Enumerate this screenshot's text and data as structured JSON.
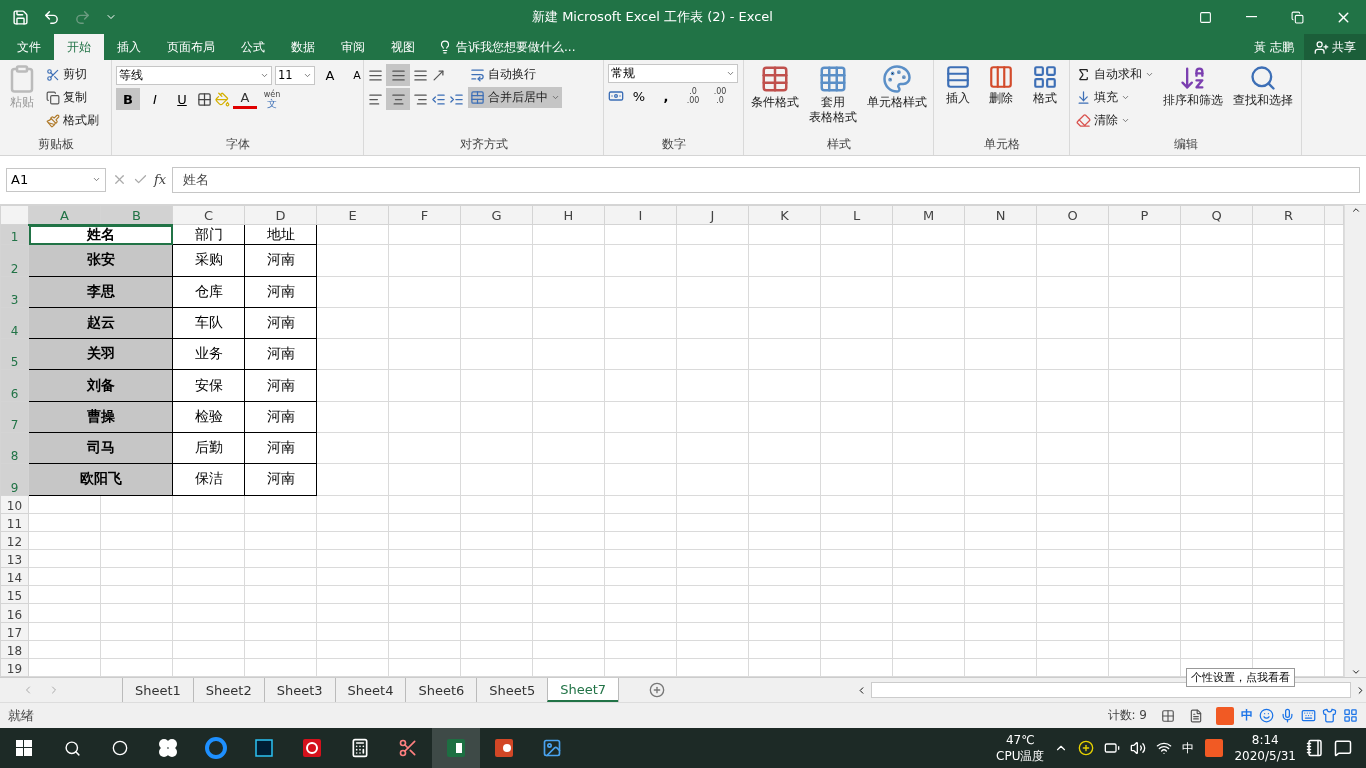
{
  "window": {
    "title": "新建 Microsoft Excel 工作表 (2) - Excel"
  },
  "ribbon_tabs": [
    {
      "label": "文件",
      "selected": false
    },
    {
      "label": "开始",
      "selected": true
    },
    {
      "label": "插入",
      "selected": false
    },
    {
      "label": "页面布局",
      "selected": false
    },
    {
      "label": "公式",
      "selected": false
    },
    {
      "label": "数据",
      "selected": false
    },
    {
      "label": "审阅",
      "selected": false
    },
    {
      "label": "视图",
      "selected": false
    }
  ],
  "tell_me": "告诉我您想要做什么...",
  "user": "黃 志鹏",
  "share": "共享",
  "clipboard": {
    "label": "剪贴板",
    "paste": "粘贴",
    "cut": "剪切",
    "copy": "复制",
    "painter": "格式刷"
  },
  "font": {
    "label": "字体",
    "font_name": "等线",
    "font_size": "11",
    "grow": "A",
    "shrink": "A",
    "bold": "B",
    "italic": "I",
    "underline": "U",
    "font_color": "A",
    "phonetic_top": "wén",
    "phonetic_bottom": "文"
  },
  "alignment": {
    "label": "对齐方式",
    "wrap": "自动换行",
    "merge": "合并后居中",
    "merge_on": true
  },
  "number": {
    "label": "数字",
    "format": "常规",
    "percent": "%",
    "comma": ",",
    "increase_top": ".0",
    "increase_bottom": ".00",
    "decrease_top": ".00",
    "decrease_bottom": ".0"
  },
  "styles": {
    "label": "样式",
    "items": [
      {
        "label": "条件格式",
        "kind": "conditional"
      },
      {
        "label": "套用",
        "label2": "表格格式",
        "kind": "table"
      },
      {
        "label": "单元格样式",
        "kind": "cellstyle"
      }
    ]
  },
  "cells": {
    "label": "单元格",
    "items": [
      {
        "label": "插入",
        "kind": "insert"
      },
      {
        "label": "删除",
        "kind": "delete"
      },
      {
        "label": "格式",
        "kind": "format"
      }
    ]
  },
  "editing": {
    "label": "编辑",
    "autosum": "自动求和",
    "fill": "填充",
    "clear": "清除",
    "sort": "排序和筛选",
    "find": "查找和选择"
  },
  "formula_bar": {
    "name_box": "A1",
    "fx": "fx",
    "value": "姓名"
  },
  "sheet": {
    "columns": [
      {
        "label": "A",
        "selected": true
      },
      {
        "label": "B",
        "selected": true
      },
      {
        "label": "C",
        "selected": false
      },
      {
        "label": "D",
        "selected": false
      },
      {
        "label": "E",
        "selected": false
      },
      {
        "label": "F",
        "selected": false
      },
      {
        "label": "G",
        "selected": false
      },
      {
        "label": "H",
        "selected": false
      },
      {
        "label": "I",
        "selected": false
      },
      {
        "label": "J",
        "selected": false
      },
      {
        "label": "K",
        "selected": false
      },
      {
        "label": "L",
        "selected": false
      },
      {
        "label": "M",
        "selected": false
      },
      {
        "label": "N",
        "selected": false
      },
      {
        "label": "O",
        "selected": false
      },
      {
        "label": "P",
        "selected": false
      },
      {
        "label": "Q",
        "selected": false
      },
      {
        "label": "R",
        "selected": false
      }
    ],
    "rows": [
      {
        "number": "1",
        "selected": true,
        "active": true,
        "name": "姓名",
        "dept": "部门",
        "addr": "地址"
      },
      {
        "number": "2",
        "selected": true,
        "active": false,
        "name": "张安",
        "dept": "采购",
        "addr": "河南"
      },
      {
        "number": "3",
        "selected": true,
        "active": false,
        "name": "李思",
        "dept": "仓库",
        "addr": "河南"
      },
      {
        "number": "4",
        "selected": true,
        "active": false,
        "name": "赵云",
        "dept": "车队",
        "addr": "河南"
      },
      {
        "number": "5",
        "selected": true,
        "active": false,
        "name": "关羽",
        "dept": "业务",
        "addr": "河南"
      },
      {
        "number": "6",
        "selected": true,
        "active": false,
        "name": "刘备",
        "dept": "安保",
        "addr": "河南"
      },
      {
        "number": "7",
        "selected": true,
        "active": false,
        "name": "曹操",
        "dept": "检验",
        "addr": "河南"
      },
      {
        "number": "8",
        "selected": true,
        "active": false,
        "name": "司马",
        "dept": "后勤",
        "addr": "河南"
      },
      {
        "number": "9",
        "selected": true,
        "active": false,
        "name": "欧阳飞",
        "dept": "保洁",
        "addr": "河南"
      }
    ],
    "empty_rows": [
      "10",
      "11",
      "12",
      "13",
      "14",
      "15",
      "16",
      "17",
      "18",
      "19"
    ]
  },
  "sheet_tabs": [
    {
      "label": "Sheet1",
      "selected": false
    },
    {
      "label": "Sheet2",
      "selected": false
    },
    {
      "label": "Sheet3",
      "selected": false
    },
    {
      "label": "Sheet4",
      "selected": false
    },
    {
      "label": "Sheet6",
      "selected": false
    },
    {
      "label": "Sheet5",
      "selected": false
    },
    {
      "label": "Sheet7",
      "selected": true
    }
  ],
  "ime_tooltip": "个性设置，点我看看",
  "status_bar": {
    "state": "就绪",
    "count": "计数: 9",
    "ime_mode": "中"
  },
  "taskbar": {
    "temperature": "47℃",
    "sensor": "CPU温度",
    "ime": "中",
    "time": "8:14",
    "date": "2020/5/31"
  }
}
